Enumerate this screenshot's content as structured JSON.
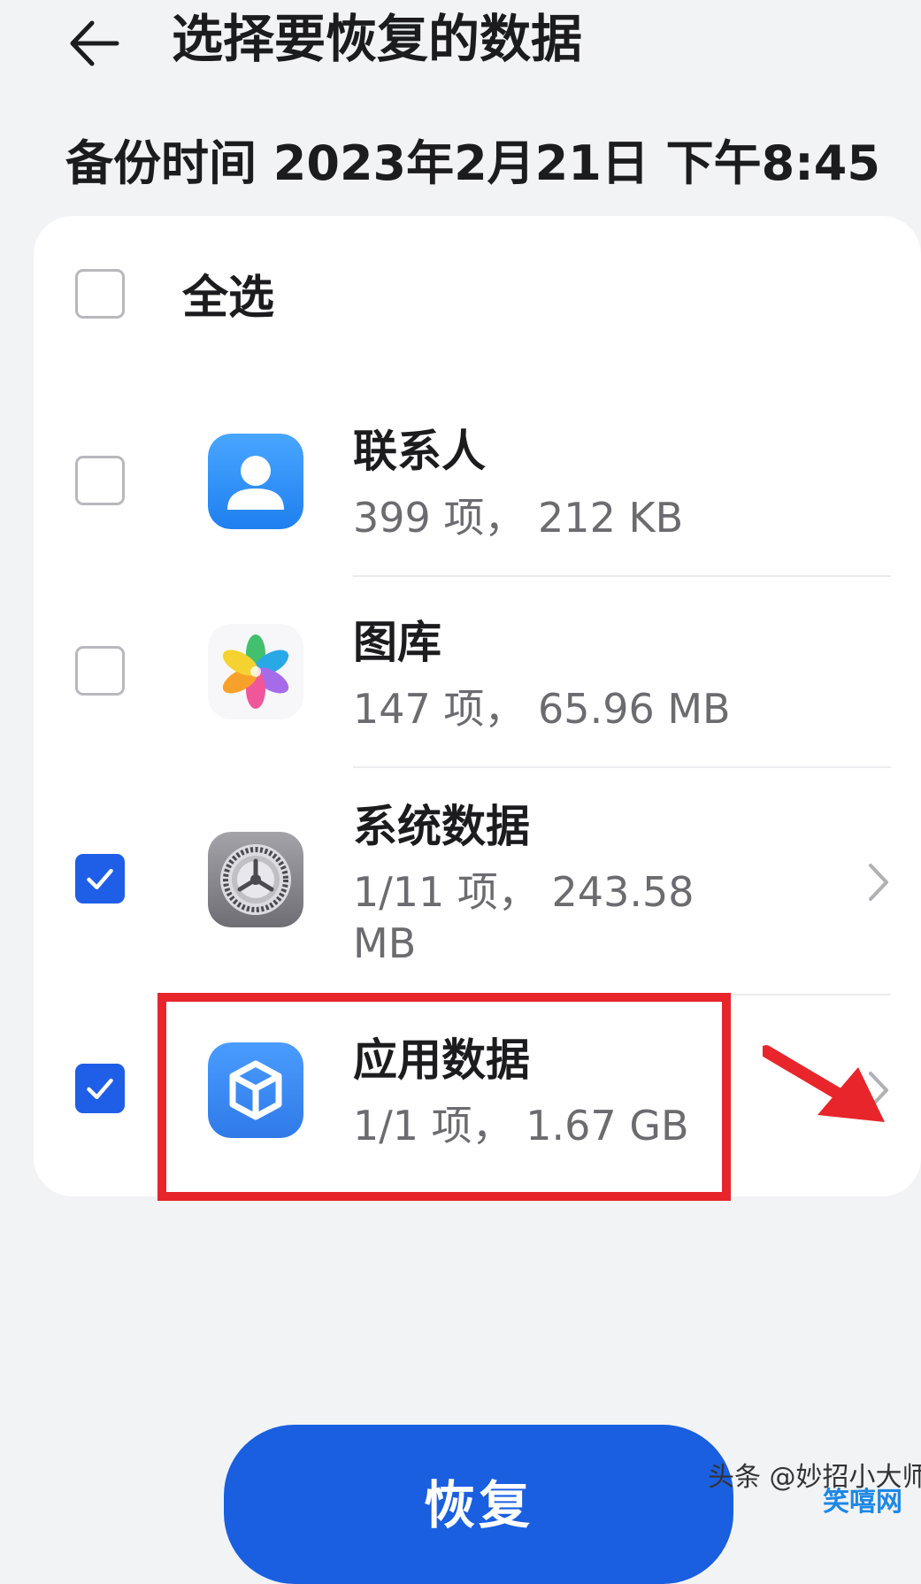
{
  "header": {
    "title": "选择要恢复的数据",
    "backup_time": "备份时间 2023年2月21日 下午8:45"
  },
  "select_all": {
    "label": "全选",
    "checked": false
  },
  "items": [
    {
      "title": "联系人",
      "meta": "399 项， 212 KB",
      "checked": false,
      "icon": "contacts-icon",
      "has_chevron": false
    },
    {
      "title": "图库",
      "meta": "147 项， 65.96 MB",
      "checked": false,
      "icon": "gallery-icon",
      "has_chevron": false
    },
    {
      "title": "系统数据",
      "meta": "1/11 项， 243.58 MB",
      "checked": true,
      "icon": "settings-gear-icon",
      "has_chevron": true
    },
    {
      "title": "应用数据",
      "meta": "1/1 项， 1.67 GB",
      "checked": true,
      "icon": "app-cube-icon",
      "has_chevron": true
    }
  ],
  "restore_button": {
    "label": "恢复"
  },
  "watermark": {
    "text": "头条 @妙招小大师",
    "logo_text": "笑嘻网"
  },
  "colors": {
    "accent": "#1f5ee6",
    "annotation": "#e8252b",
    "background": "#f1f3f5"
  }
}
